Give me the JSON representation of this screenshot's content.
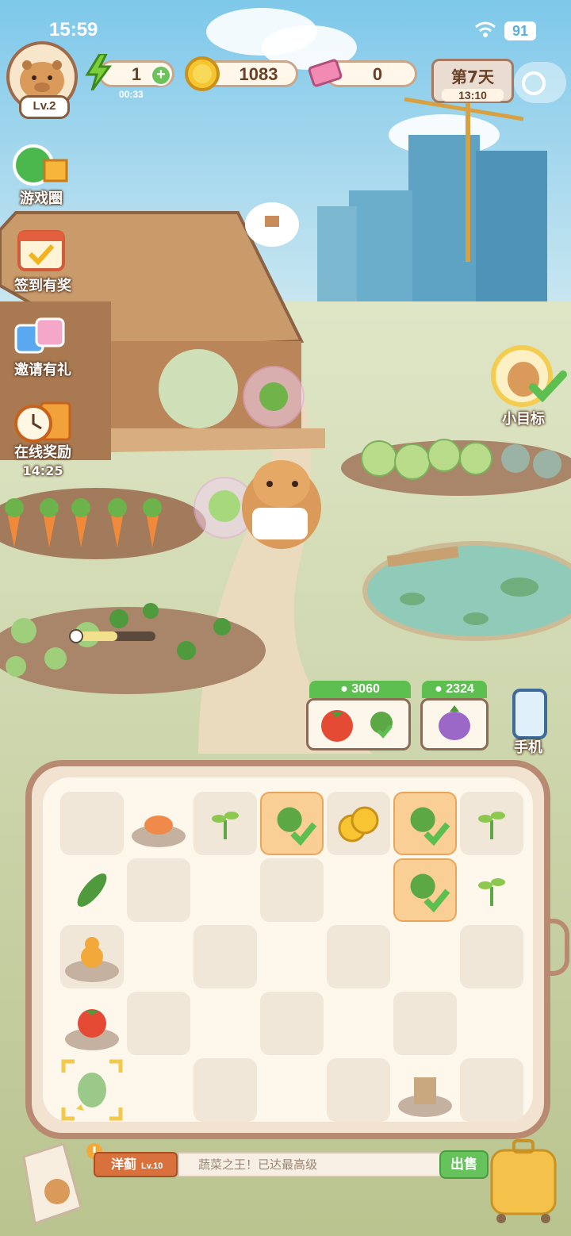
{
  "status_bar": {
    "time": "15:59",
    "battery": "91",
    "wifi_icon": "wifi-icon"
  },
  "player": {
    "level": "Lv.2"
  },
  "resources": {
    "energy": {
      "value": "1",
      "timer": "00:33"
    },
    "coins": {
      "value": "1083"
    },
    "tickets": {
      "value": "0"
    }
  },
  "day": {
    "label": "第7天",
    "time": "13:10"
  },
  "left_menu": [
    {
      "label": "游戏圈",
      "icon": "game-circle-icon"
    },
    {
      "label": "签到有奖",
      "icon": "calendar-icon"
    },
    {
      "label": "邀请有礼",
      "icon": "gift-icon"
    },
    {
      "label": "在线奖励",
      "icon": "clock-gift-icon",
      "timer": "14:25"
    }
  ],
  "goal": {
    "label": "小目标"
  },
  "phone": {
    "label": "手机"
  },
  "orders": [
    {
      "price": "3060",
      "items": [
        "tomato",
        "seedling"
      ],
      "ready": true
    },
    {
      "price": "2324",
      "items": [
        "onion"
      ],
      "ready": false
    }
  ],
  "board": {
    "selected_item": {
      "name": "洋蓟",
      "level": "Lv.10",
      "description": "蔬菜之王！已达最高级"
    },
    "sell_label": "出售",
    "cells": [
      [
        "",
        "crab",
        "sprout",
        "seedling-check",
        "coins",
        "seedling-check",
        "sprout"
      ],
      [
        "cucumber",
        "",
        "",
        "",
        "",
        "seedling-check",
        "sprout"
      ],
      [
        "gourd",
        "",
        "",
        "",
        "",
        "",
        ""
      ],
      [
        "tomato",
        "",
        "",
        "",
        "",
        "",
        ""
      ],
      [
        "artichoke",
        "",
        "",
        "",
        "",
        "stump",
        ""
      ]
    ]
  },
  "colors": {
    "accent_green": "#66c25b",
    "board_border": "#b98a72",
    "selected_cell": "#f9cf95"
  }
}
